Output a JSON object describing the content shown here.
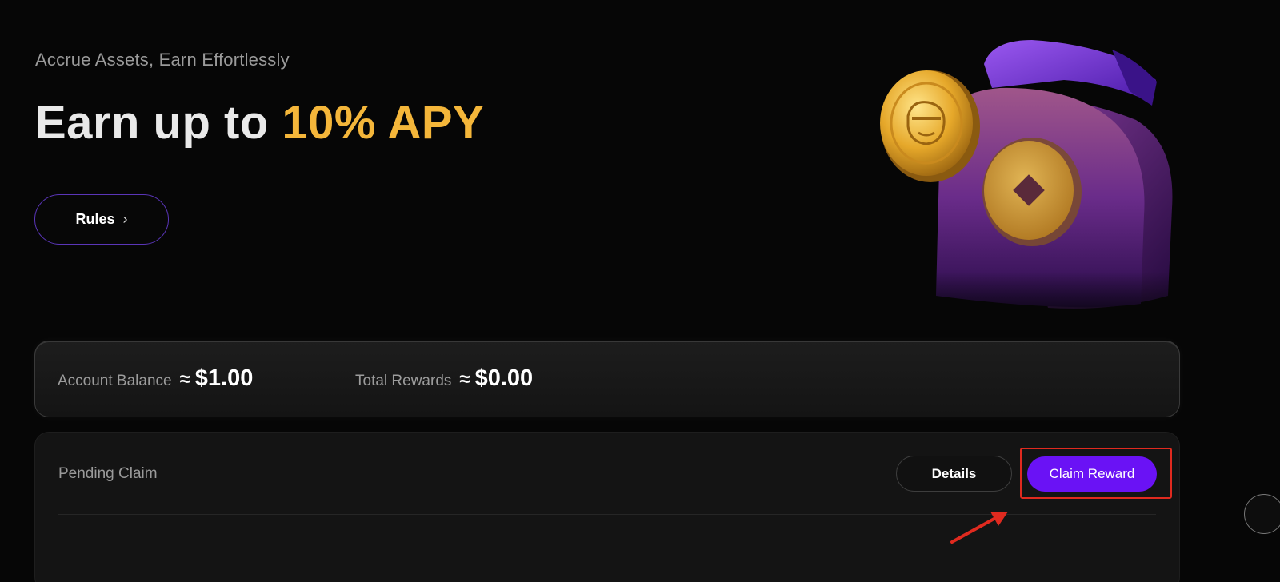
{
  "hero": {
    "subtitle": "Accrue Assets, Earn Effortlessly",
    "headline_prefix": "Earn up to ",
    "headline_accent": "10% APY",
    "rules_label": "Rules",
    "rules_chevron": "›"
  },
  "balances": {
    "account_label": "Account Balance",
    "account_approx": "≈",
    "account_value": "$1.00",
    "rewards_label": "Total Rewards",
    "rewards_approx": "≈",
    "rewards_value": "$0.00"
  },
  "pending": {
    "title": "Pending Claim",
    "details_label": "Details",
    "claim_label": "Claim Reward"
  },
  "colors": {
    "accent_gold": "#f4b63a",
    "primary_purple": "#6a12f5",
    "highlight_red": "#e02a1f"
  },
  "icons": {
    "hero_illustration": "coin-wallet-illustration",
    "annotation": "red-arrow-icon"
  }
}
